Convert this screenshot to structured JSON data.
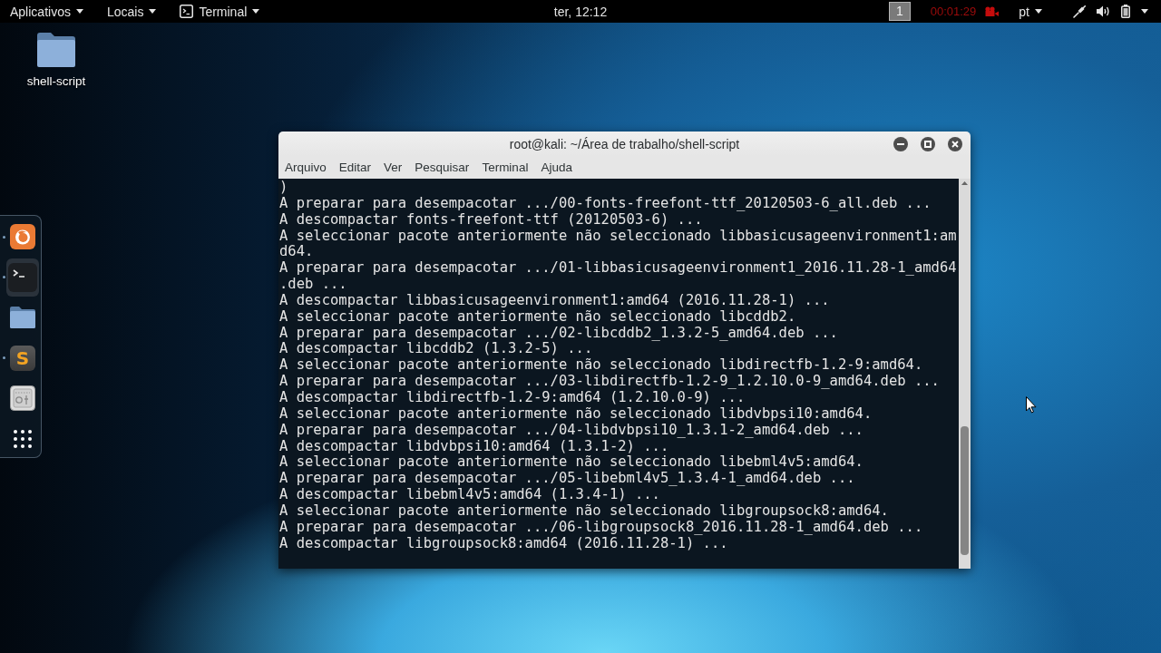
{
  "top_bar": {
    "menus": [
      {
        "label": "Aplicativos",
        "kind": "menu"
      },
      {
        "label": "Locais",
        "kind": "menu"
      },
      {
        "label": "Terminal",
        "kind": "app"
      }
    ],
    "clock": "ter, 12:12",
    "workspace": "1",
    "recording_timer": "00:01:29",
    "keyboard_layout": "pt"
  },
  "desktop_icons": [
    {
      "label": "shell-script",
      "kind": "folder"
    }
  ],
  "dock": {
    "apps": [
      {
        "kind": "browser",
        "running": true,
        "selected": false
      },
      {
        "kind": "terminal",
        "running": true,
        "selected": true
      },
      {
        "kind": "files",
        "running": false,
        "selected": false
      },
      {
        "kind": "editor",
        "glyph": "S",
        "running": true,
        "selected": false
      },
      {
        "kind": "settings",
        "running": false,
        "selected": false
      }
    ]
  },
  "window": {
    "title": "root@kali: ~/Área de trabalho/shell-script",
    "menu": [
      "Arquivo",
      "Editar",
      "Ver",
      "Pesquisar",
      "Terminal",
      "Ajuda"
    ],
    "lines": [
      ")",
      "A preparar para desempacotar .../00-fonts-freefont-ttf_20120503-6_all.deb ...",
      "A descompactar fonts-freefont-ttf (20120503-6) ...",
      "A seleccionar pacote anteriormente não seleccionado libbasicusageenvironment1:amd64.",
      "A preparar para desempacotar .../01-libbasicusageenvironment1_2016.11.28-1_amd64.deb ...",
      "A descompactar libbasicusageenvironment1:amd64 (2016.11.28-1) ...",
      "A seleccionar pacote anteriormente não seleccionado libcddb2.",
      "A preparar para desempacotar .../02-libcddb2_1.3.2-5_amd64.deb ...",
      "A descompactar libcddb2 (1.3.2-5) ...",
      "A seleccionar pacote anteriormente não seleccionado libdirectfb-1.2-9:amd64.",
      "A preparar para desempacotar .../03-libdirectfb-1.2-9_1.2.10.0-9_amd64.deb ...",
      "A descompactar libdirectfb-1.2-9:amd64 (1.2.10.0-9) ...",
      "A seleccionar pacote anteriormente não seleccionado libdvbpsi10:amd64.",
      "A preparar para desempacotar .../04-libdvbpsi10_1.3.1-2_amd64.deb ...",
      "A descompactar libdvbpsi10:amd64 (1.3.1-2) ...",
      "A seleccionar pacote anteriormente não seleccionado libebml4v5:amd64.",
      "A preparar para desempacotar .../05-libebml4v5_1.3.4-1_amd64.deb ...",
      "A descompactar libebml4v5:amd64 (1.3.4-1) ...",
      "A seleccionar pacote anteriormente não seleccionado libgroupsock8:amd64.",
      "A preparar para desempacotar .../06-libgroupsock8_2016.11.28-1_amd64.deb ...",
      "A descompactar libgroupsock8:amd64 (2016.11.28-1) ..."
    ]
  }
}
